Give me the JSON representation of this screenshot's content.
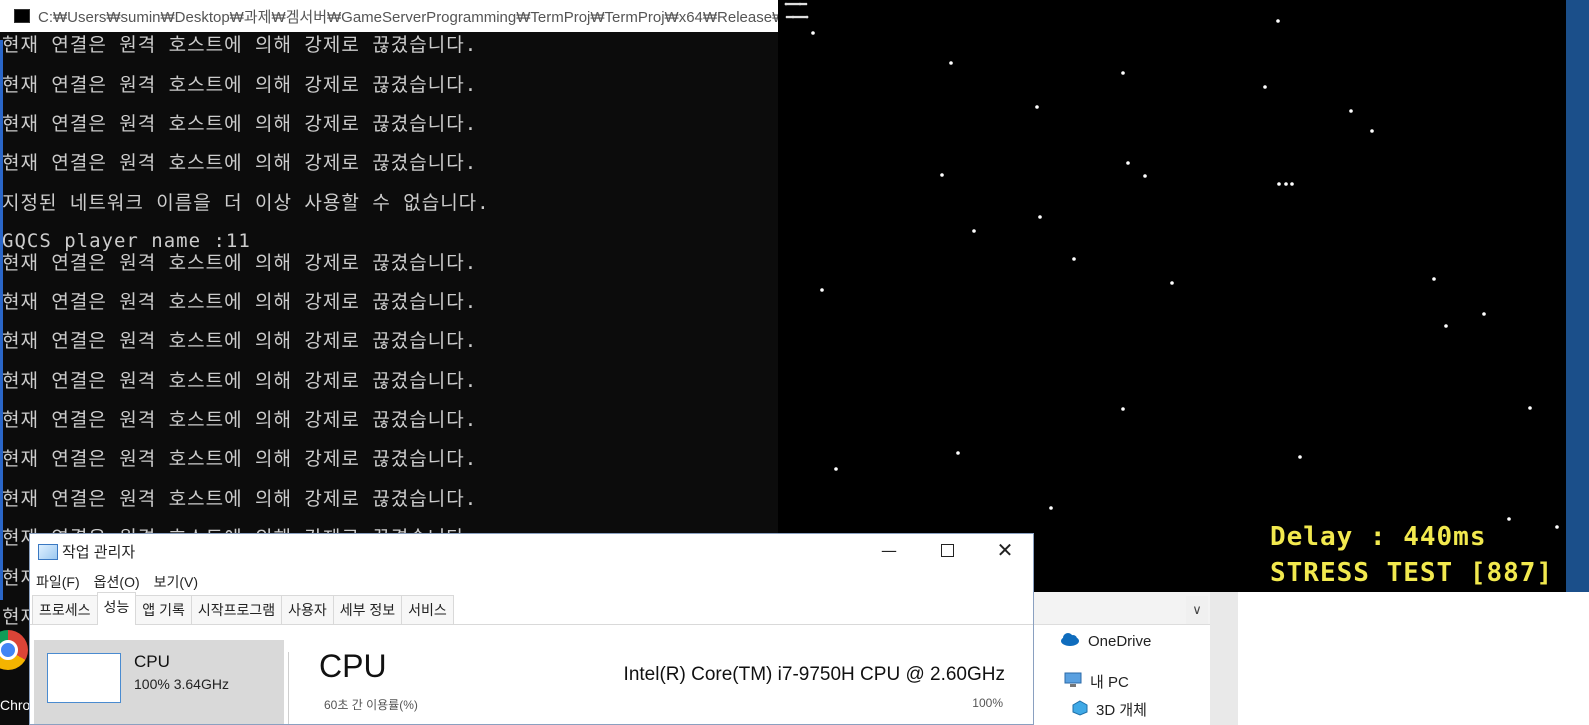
{
  "console": {
    "title": "C:₩Users₩sumin₩Desktop₩과제₩겜서버₩GameServerProgramming₩TermProj₩TermProj₩x64₩Release₩TermProj.exe",
    "lines": [
      "현재 연결은 원격 호스트에 의해 강제로 끊겼습니다.",
      "현재 연결은 원격 호스트에 의해 강제로 끊겼습니다.",
      "현재 연결은 원격 호스트에 의해 강제로 끊겼습니다.",
      "현재 연결은 원격 호스트에 의해 강제로 끊겼습니다.",
      "지정된 네트워크 이름을 더 이상 사용할 수 없습니다.",
      "GQCS player name :11",
      "현재 연결은 원격 호스트에 의해 강제로 끊겼습니다.",
      "현재 연결은 원격 호스트에 의해 강제로 끊겼습니다.",
      "현재 연결은 원격 호스트에 의해 강제로 끊겼습니다.",
      "현재 연결은 원격 호스트에 의해 강제로 끊겼습니다.",
      "현재 연결은 원격 호스트에 의해 강제로 끊겼습니다.",
      "현재 연결은 원격 호스트에 의해 강제로 끊겼습니다.",
      "현재 연결은 원격 호스트에 의해 강제로 끊겼습니다.",
      "현재 연결은 원격 호스트에 의해 강제로 끊겼습니다.",
      "현재",
      "현재"
    ]
  },
  "game": {
    "delay_text": "Delay : 440ms",
    "stress_text": "STRESS TEST [887]",
    "text_color": "#f2e94e"
  },
  "taskbar": {
    "chrome_label": "Chro"
  },
  "explorer": {
    "items": [
      {
        "label": "OneDrive",
        "icon": "cloud-icon"
      },
      {
        "label": "내 PC",
        "icon": "pc-icon"
      },
      {
        "label": "3D 개체",
        "icon": "cube-icon"
      }
    ]
  },
  "taskmgr": {
    "title": "작업 관리자",
    "menu": [
      "파일(F)",
      "옵션(O)",
      "보기(V)"
    ],
    "tabs": [
      "프로세스",
      "성능",
      "앱 기록",
      "시작프로그램",
      "사용자",
      "세부 정보",
      "서비스"
    ],
    "active_tab": "성능",
    "cpu_side_label": "CPU",
    "cpu_side_value": "100%  3.64GHz",
    "cpu_heading": "CPU",
    "cpu_model": "Intel(R) Core(TM) i7-9750H CPU @ 2.60GHz",
    "util_label": "60초 간 이용률(%)",
    "util_max": "100%"
  }
}
